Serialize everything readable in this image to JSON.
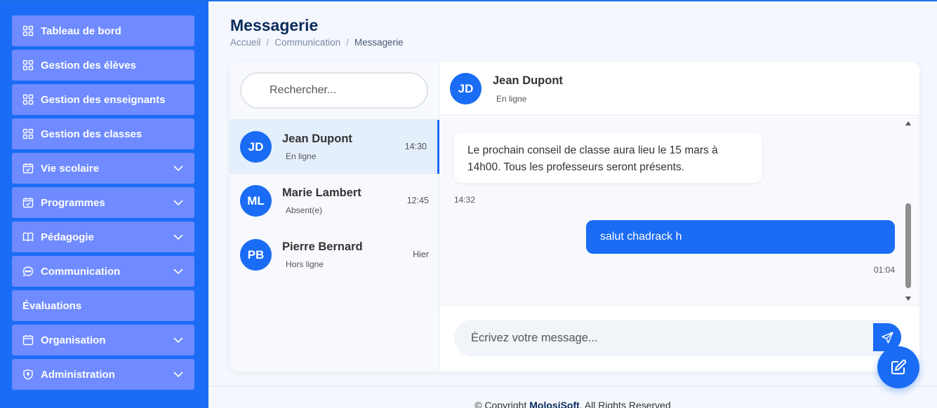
{
  "sidebar": {
    "items": [
      {
        "label": "Tableau de bord",
        "icon": "grid-icon",
        "chevron": false
      },
      {
        "label": "Gestion des élèves",
        "icon": "grid-icon",
        "chevron": false
      },
      {
        "label": "Gestion des enseignants",
        "icon": "grid-icon",
        "chevron": false
      },
      {
        "label": "Gestion des classes",
        "icon": "grid-icon",
        "chevron": false
      },
      {
        "label": "Vie scolaire",
        "icon": "calendar-check-icon",
        "chevron": true
      },
      {
        "label": "Programmes",
        "icon": "calendar-check-icon",
        "chevron": true
      },
      {
        "label": "Pédagogie",
        "icon": "book-icon",
        "chevron": true
      },
      {
        "label": "Communication",
        "icon": "chat-dots-icon",
        "chevron": true
      },
      {
        "label": "Évaluations",
        "icon": "",
        "chevron": false
      },
      {
        "label": "Organisation",
        "icon": "calendar-icon",
        "chevron": true
      },
      {
        "label": "Administration",
        "icon": "shield-icon",
        "chevron": true
      }
    ]
  },
  "header": {
    "title": "Messagerie",
    "breadcrumb": [
      "Accueil",
      "Communication",
      "Messagerie"
    ],
    "separator": "/"
  },
  "search": {
    "placeholder": "Rechercher..."
  },
  "conversations": [
    {
      "initials": "JD",
      "name": "Jean Dupont",
      "status": "En ligne",
      "time": "14:30",
      "active": true
    },
    {
      "initials": "ML",
      "name": "Marie Lambert",
      "status": "Absent(e)",
      "time": "12:45",
      "active": false
    },
    {
      "initials": "PB",
      "name": "Pierre Bernard",
      "status": "Hors ligne",
      "time": "Hier",
      "active": false
    }
  ],
  "chat": {
    "contact": {
      "initials": "JD",
      "name": "Jean Dupont",
      "status": "En ligne"
    },
    "messages": [
      {
        "direction": "in",
        "text": "Le prochain conseil de classe aura lieu le 15 mars à 14h00. Tous les professeurs seront présents.",
        "time": "14:32"
      },
      {
        "direction": "out",
        "text": "salut chadrack h",
        "time": "01:04"
      }
    ],
    "compose_placeholder": "Écrivez votre message..."
  },
  "footer": {
    "prefix": "© Copyright",
    "brand": "MolosiSoft",
    "suffix": "All Rights Reserved"
  },
  "colors": {
    "primary": "#1a6cf5",
    "nav_item": "#6f8bff",
    "title": "#0b2c5e"
  }
}
